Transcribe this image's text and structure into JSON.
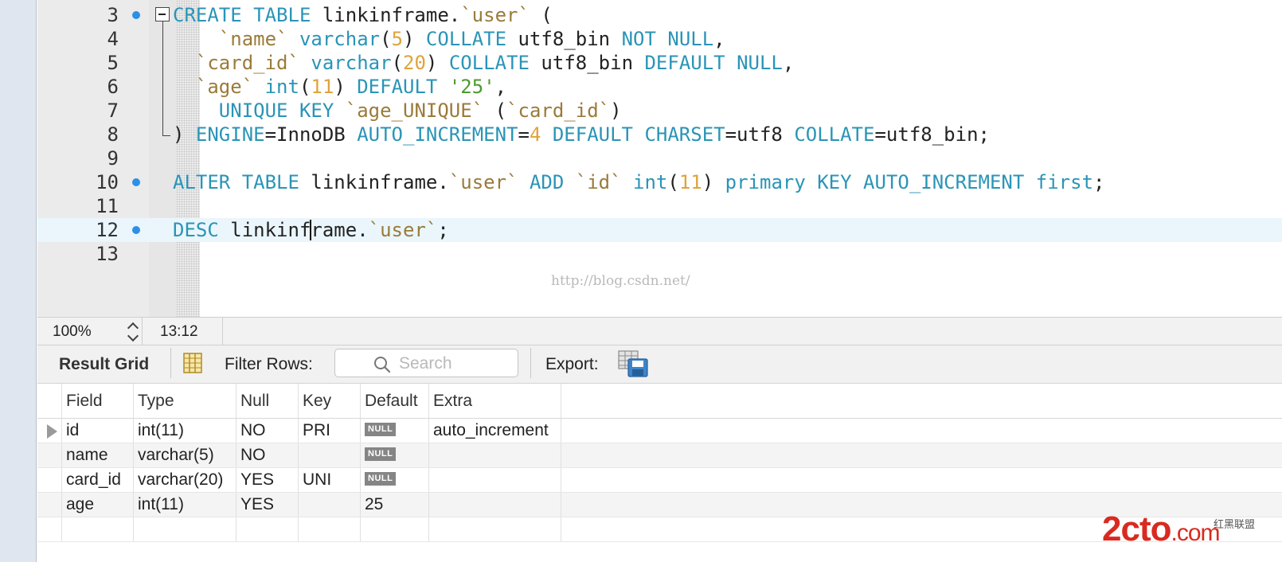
{
  "editor": {
    "line_numbers": [
      "3",
      "4",
      "5",
      "6",
      "7",
      "8",
      "9",
      "10",
      "11",
      "12",
      "13"
    ],
    "lines": [
      [
        {
          "t": "CREATE TABLE",
          "c": "kw"
        },
        {
          "t": " linkinframe."
        },
        {
          "t": "`user`",
          "c": "tick"
        },
        {
          "t": " ("
        }
      ],
      [
        {
          "t": "    "
        },
        {
          "t": "`name`",
          "c": "tick"
        },
        {
          "t": " "
        },
        {
          "t": "varchar",
          "c": "kw"
        },
        {
          "t": "("
        },
        {
          "t": "5",
          "c": "num"
        },
        {
          "t": ") "
        },
        {
          "t": "COLLATE",
          "c": "kw"
        },
        {
          "t": " utf8_bin "
        },
        {
          "t": "NOT NULL",
          "c": "kw"
        },
        {
          "t": ","
        }
      ],
      [
        {
          "t": "  "
        },
        {
          "t": "`card_id`",
          "c": "tick"
        },
        {
          "t": " "
        },
        {
          "t": "varchar",
          "c": "kw"
        },
        {
          "t": "("
        },
        {
          "t": "20",
          "c": "num"
        },
        {
          "t": ") "
        },
        {
          "t": "COLLATE",
          "c": "kw"
        },
        {
          "t": " utf8_bin "
        },
        {
          "t": "DEFAULT NULL",
          "c": "kw"
        },
        {
          "t": ","
        }
      ],
      [
        {
          "t": "  "
        },
        {
          "t": "`age`",
          "c": "tick"
        },
        {
          "t": " "
        },
        {
          "t": "int",
          "c": "kw"
        },
        {
          "t": "("
        },
        {
          "t": "11",
          "c": "num"
        },
        {
          "t": ") "
        },
        {
          "t": "DEFAULT",
          "c": "kw"
        },
        {
          "t": " "
        },
        {
          "t": "'25'",
          "c": "str"
        },
        {
          "t": ","
        }
      ],
      [
        {
          "t": "    "
        },
        {
          "t": "UNIQUE KEY",
          "c": "kw"
        },
        {
          "t": " "
        },
        {
          "t": "`age_UNIQUE`",
          "c": "tick"
        },
        {
          "t": " ("
        },
        {
          "t": "`card_id`",
          "c": "tick"
        },
        {
          "t": ")"
        }
      ],
      [
        {
          "t": ") "
        },
        {
          "t": "ENGINE",
          "c": "kw"
        },
        {
          "t": "=InnoDB "
        },
        {
          "t": "AUTO_INCREMENT",
          "c": "kw"
        },
        {
          "t": "="
        },
        {
          "t": "4",
          "c": "num"
        },
        {
          "t": " "
        },
        {
          "t": "DEFAULT CHARSET",
          "c": "kw"
        },
        {
          "t": "=utf8 "
        },
        {
          "t": "COLLATE",
          "c": "kw"
        },
        {
          "t": "=utf8_bin;"
        }
      ],
      [],
      [
        {
          "t": "ALTER TABLE",
          "c": "kw"
        },
        {
          "t": " linkinframe."
        },
        {
          "t": "`user`",
          "c": "tick"
        },
        {
          "t": " "
        },
        {
          "t": "ADD",
          "c": "kw"
        },
        {
          "t": " "
        },
        {
          "t": "`id`",
          "c": "tick"
        },
        {
          "t": " "
        },
        {
          "t": "int",
          "c": "kw"
        },
        {
          "t": "("
        },
        {
          "t": "11",
          "c": "num"
        },
        {
          "t": ") "
        },
        {
          "t": "primary KEY AUTO_INCREMENT first",
          "c": "kw"
        },
        {
          "t": ";"
        }
      ],
      [],
      [
        {
          "t": "DESC",
          "c": "kw"
        },
        {
          "t": " linkinf"
        },
        {
          "caret": true
        },
        {
          "t": "rame."
        },
        {
          "t": "`user`",
          "c": "tick"
        },
        {
          "t": ";"
        }
      ],
      []
    ],
    "breakpoint_lines": [
      "3",
      "10",
      "12"
    ],
    "watermark": "http://blog.csdn.net/",
    "colors": {
      "keyword": "#2a94b7",
      "backtick_identifier": "#9a7b3a",
      "number": "#e0a33c",
      "string": "#4b9a2e",
      "breakpoint": "#2c8fe8",
      "current_line": "#eaf6fb"
    }
  },
  "statusbar": {
    "zoom": "100%",
    "cursor_position": "13:12"
  },
  "result_toolbar": {
    "title": "Result Grid",
    "filter_label": "Filter Rows:",
    "search_placeholder": "Search",
    "search_value": "",
    "export_label": "Export:"
  },
  "result_table": {
    "columns": [
      "Field",
      "Type",
      "Null",
      "Key",
      "Default",
      "Extra"
    ],
    "rows": [
      [
        "id",
        "int(11)",
        "NO",
        "PRI",
        "NULL",
        "auto_increment"
      ],
      [
        "name",
        "varchar(5)",
        "NO",
        "",
        "NULL",
        ""
      ],
      [
        "card_id",
        "varchar(20)",
        "YES",
        "UNI",
        "NULL",
        ""
      ],
      [
        "age",
        "int(11)",
        "YES",
        "",
        "25",
        ""
      ]
    ],
    "selected_row": 0
  },
  "footer_logo": {
    "main": "2cto",
    "suffix": ".com",
    "sub": "红黑联盟"
  }
}
